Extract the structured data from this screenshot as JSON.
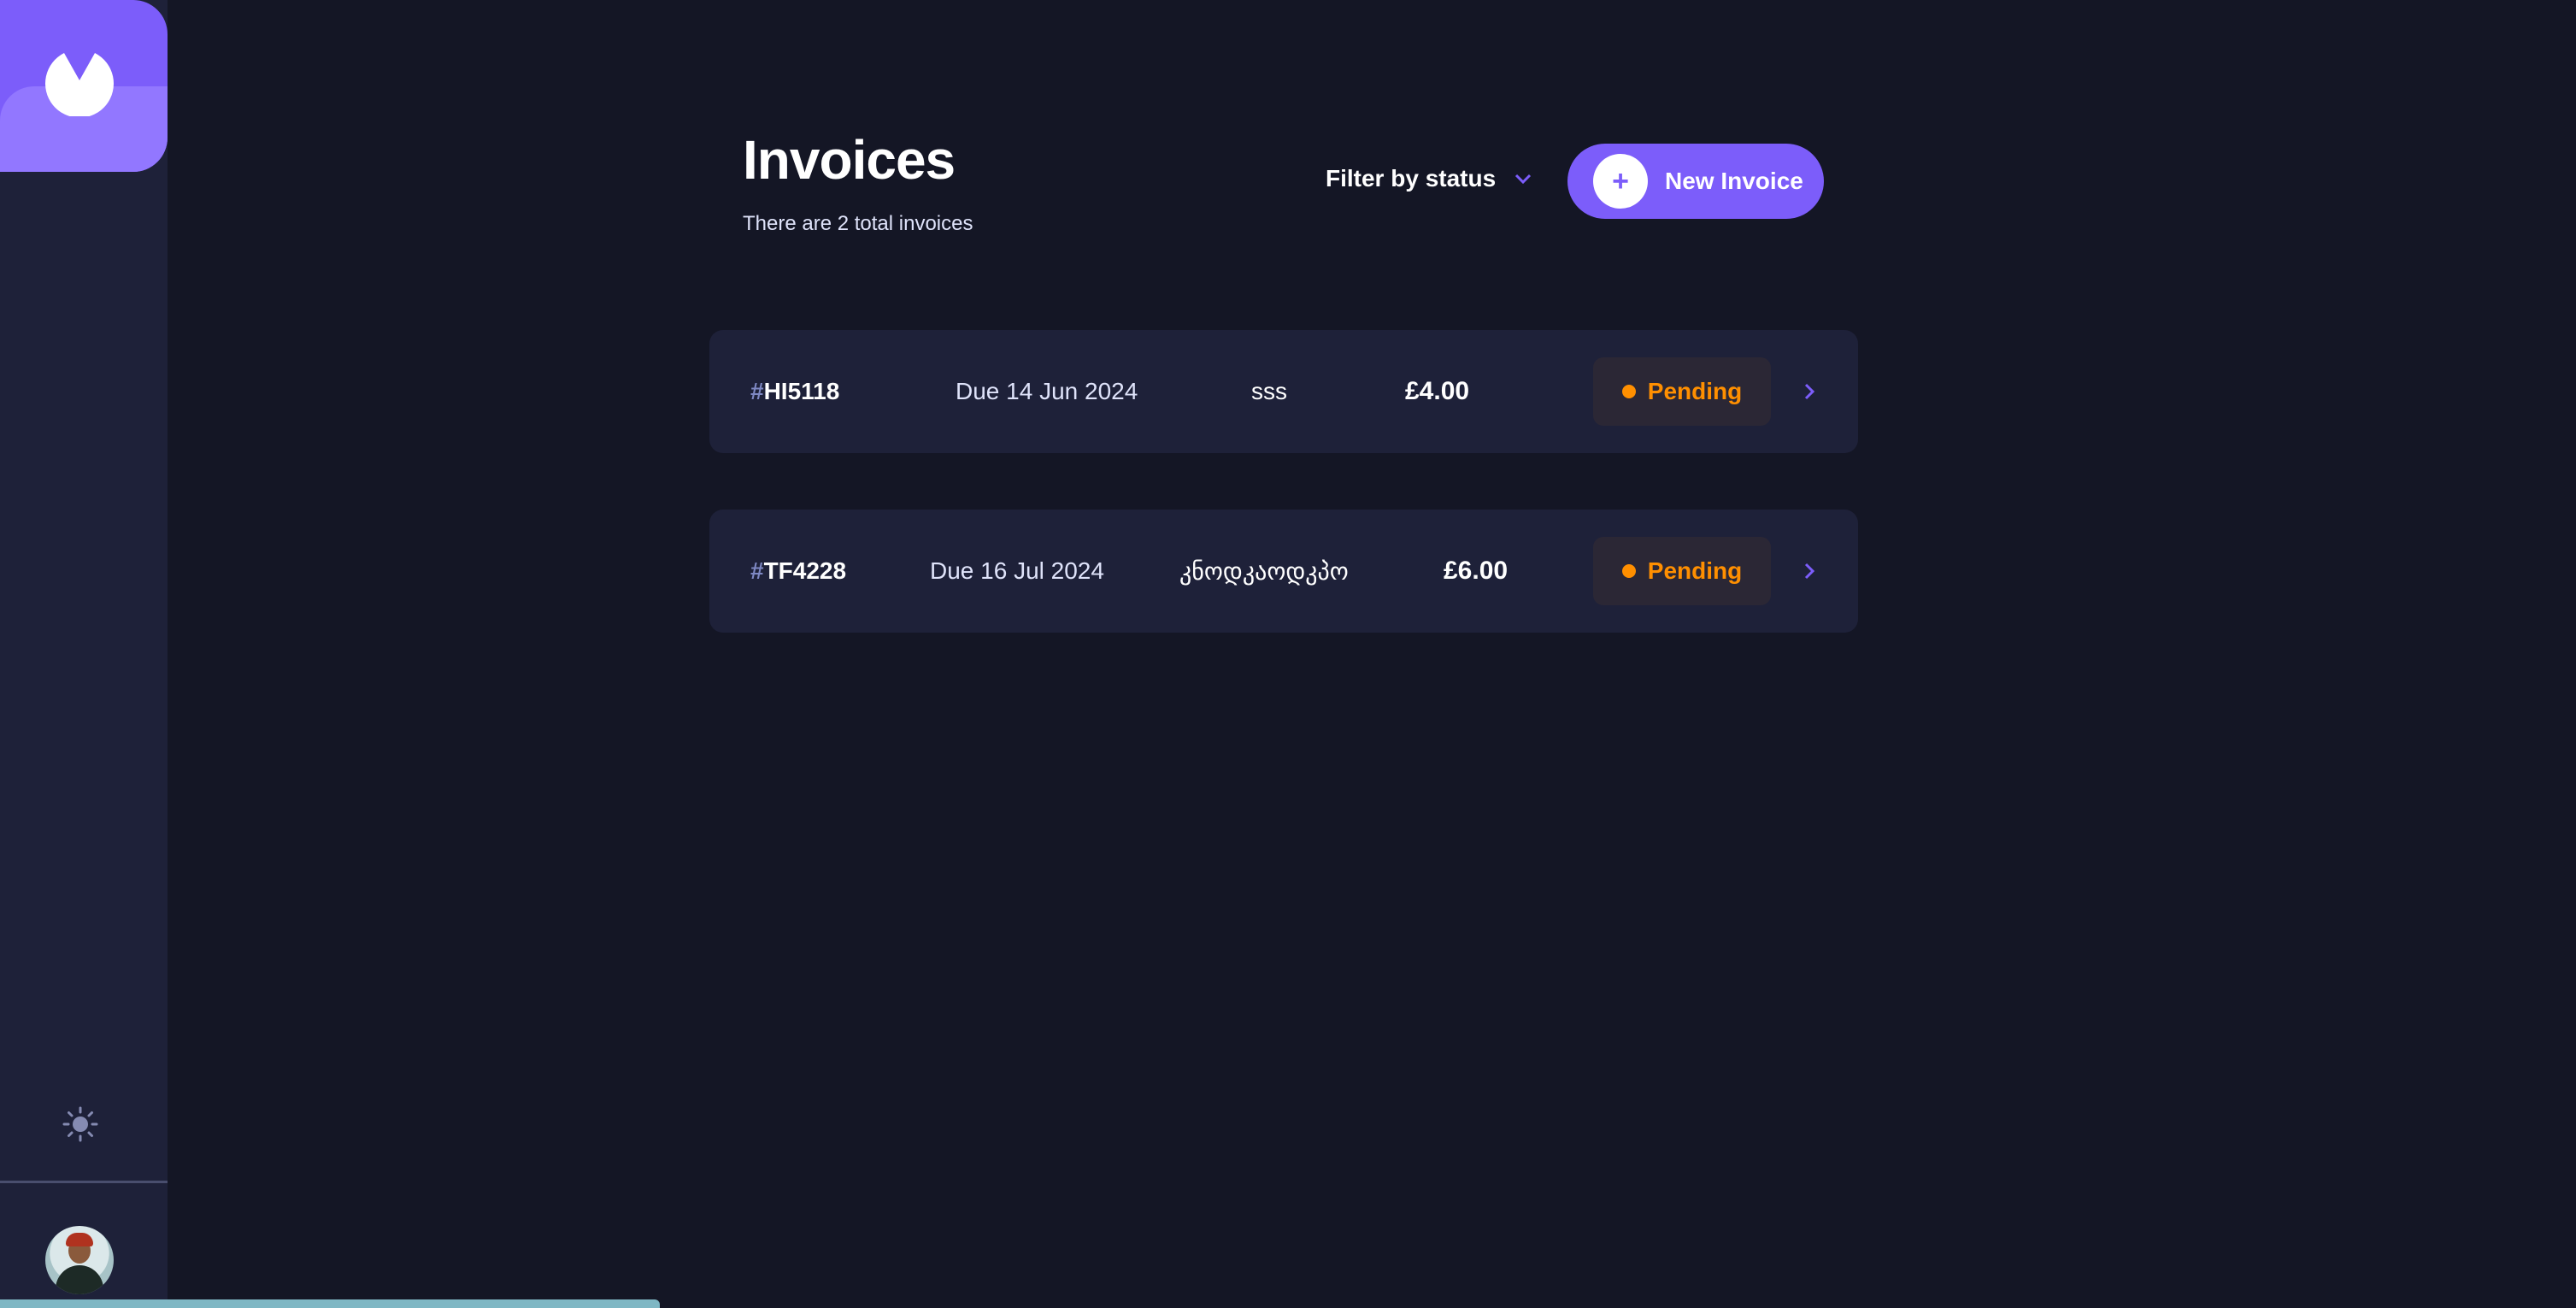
{
  "header": {
    "title": "Invoices",
    "subtitle": "There are 2 total invoices",
    "filter_label": "Filter by status",
    "new_button_label": "New Invoice"
  },
  "invoices": [
    {
      "hash": "#",
      "id": "HI5118",
      "due": "Due 14 Jun 2024",
      "client": "sss",
      "amount": "£4.00",
      "status": "Pending"
    },
    {
      "hash": "#",
      "id": "TF4228",
      "due": "Due 16 Jul 2024",
      "client": "კნოდკაოდკპო",
      "amount": "£6.00",
      "status": "Pending"
    }
  ],
  "colors": {
    "background": "#141625",
    "sidebar": "#1e2139",
    "accent": "#7c5dfa",
    "pending": "#ff8f00",
    "muted": "#7e88c3"
  },
  "icons": {
    "logo": "app-logo-icon",
    "theme": "sun-icon",
    "filter": "chevron-down-icon",
    "add": "plus-icon",
    "row": "chevron-right-icon"
  }
}
